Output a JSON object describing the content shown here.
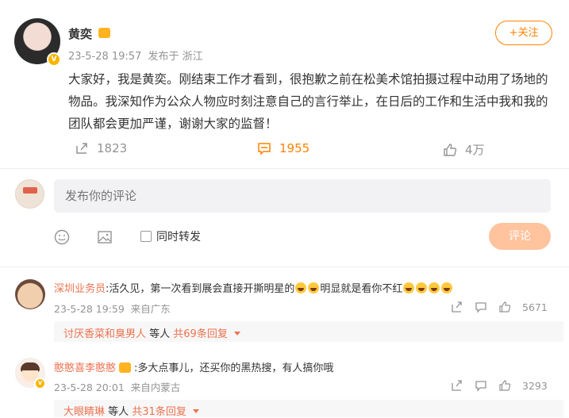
{
  "colors": {
    "accent": "#ff8200",
    "link": "#eb7350",
    "muted": "#939393"
  },
  "post": {
    "author": "黄奕",
    "time": "23-5-28 19:57",
    "source": "发布于 浙江",
    "follow_label": "+关注",
    "text": "大家好，我是黄奕。刚结束工作才看到，很抱歉之前在松美术馆拍摄过程中动用了场地的物品。我深知作为公众人物应时刻注意自己的言行举止，在日后的工作和生活中我和我的团队都会更加严谨，谢谢大家的监督！",
    "reposts": "1823",
    "comments": "1955",
    "likes": "4万"
  },
  "composer": {
    "placeholder": "发布你的评论",
    "repost_label": "同时转发",
    "submit_label": "评论",
    "icons": [
      "emoji-icon",
      "image-icon"
    ]
  },
  "comments": [
    {
      "user": "深圳业务员",
      "text_a": ":活久见，第一次看到展会直接开撕明星的",
      "text_b": "明显就是看你不红",
      "time": "23-5-28 19:59",
      "location": "来自广东",
      "likes": "5671",
      "reply_user": "讨厌香菜和臭男人",
      "reply_mid": " 等人 ",
      "reply_count": "共69条回复"
    },
    {
      "user": "憨憨喜李憨憨",
      "text_a": ":多大点事儿，还买你的黑热搜，有人搞你哦",
      "time": "23-5-28 20:01",
      "location": "来自内蒙古",
      "likes": "3293",
      "reply_user": "大眼睛琳",
      "reply_mid": " 等人 ",
      "reply_count": "共31条回复"
    }
  ]
}
